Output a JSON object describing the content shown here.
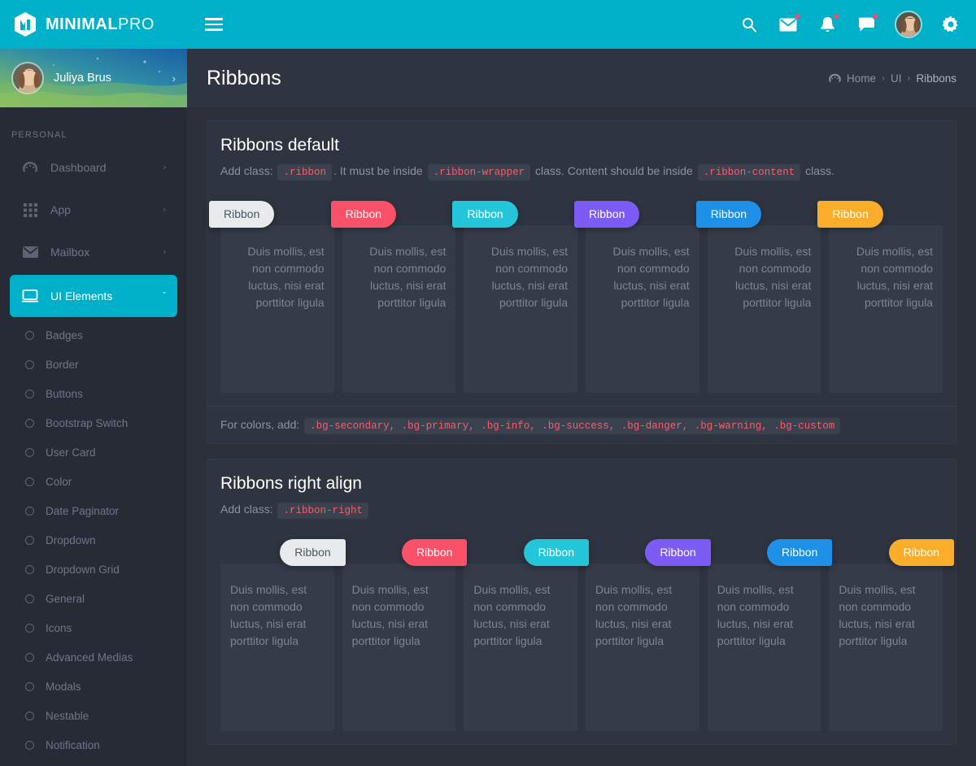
{
  "brand": {
    "bold": "MINIMAL",
    "light": "PRO"
  },
  "topbar": {
    "menu_toggle": "menu-toggle",
    "icons": [
      {
        "name": "search-icon",
        "badge": false
      },
      {
        "name": "mail-icon",
        "badge": true
      },
      {
        "name": "bell-icon",
        "badge": true
      },
      {
        "name": "chat-icon",
        "badge": true
      }
    ]
  },
  "profile": {
    "name": "Juliya Brus",
    "caret": "›"
  },
  "sidebar": {
    "section_title": "PERSONAL",
    "items": [
      {
        "label": "Dashboard",
        "icon": "gauge-icon",
        "caret": "›",
        "active": false
      },
      {
        "label": "App",
        "icon": "grid-icon",
        "caret": "›",
        "active": false
      },
      {
        "label": "Mailbox",
        "icon": "envelope-icon",
        "caret": "›",
        "active": false
      },
      {
        "label": "UI Elements",
        "icon": "monitor-icon",
        "caret": "ˇ",
        "active": true
      }
    ],
    "sub_items": [
      {
        "label": "Badges"
      },
      {
        "label": "Border"
      },
      {
        "label": "Buttons"
      },
      {
        "label": "Bootstrap Switch"
      },
      {
        "label": "User Card"
      },
      {
        "label": "Color"
      },
      {
        "label": "Date Paginator"
      },
      {
        "label": "Dropdown"
      },
      {
        "label": "Dropdown Grid"
      },
      {
        "label": "General"
      },
      {
        "label": "Icons"
      },
      {
        "label": "Advanced Medias"
      },
      {
        "label": "Modals"
      },
      {
        "label": "Nestable"
      },
      {
        "label": "Notification"
      }
    ]
  },
  "page": {
    "title": "Ribbons",
    "breadcrumb": {
      "home": "Home",
      "section": "UI",
      "current": "Ribbons",
      "sep": "›"
    }
  },
  "cards": [
    {
      "title": "Ribbons default",
      "desc_parts": [
        {
          "type": "text",
          "value": "Add class: "
        },
        {
          "type": "code",
          "value": ".ribbon"
        },
        {
          "type": "text",
          "value": ". It must be inside "
        },
        {
          "type": "code",
          "value": ".ribbon-wrapper"
        },
        {
          "type": "text",
          "value": " class. Content should be inside "
        },
        {
          "type": "code",
          "value": ".ribbon-content"
        },
        {
          "type": "text",
          "value": " class."
        }
      ],
      "align": "left",
      "footer": {
        "label": "For colors, add:",
        "code": ".bg-secondary, .bg-primary, .bg-info, .bg-success, .bg-danger, .bg-warning, .bg-custom"
      },
      "ribbons": [
        {
          "label": "Ribbon",
          "variant": "bg-secondary",
          "color": "#e7ebee"
        },
        {
          "label": "Ribbon",
          "variant": "bg-primary",
          "color": "#fa5068"
        },
        {
          "label": "Ribbon",
          "variant": "bg-info",
          "color": "#26c6da"
        },
        {
          "label": "Ribbon",
          "variant": "bg-success",
          "color": "#7c5cf5"
        },
        {
          "label": "Ribbon",
          "variant": "bg-danger",
          "color": "#1e90e8"
        },
        {
          "label": "Ribbon",
          "variant": "bg-warning",
          "color": "#f9ad2a"
        }
      ],
      "content_text": "Duis mollis, est non commodo luctus, nisi erat porttitor ligula"
    },
    {
      "title": "Ribbons right align",
      "desc_parts": [
        {
          "type": "text",
          "value": "Add class: "
        },
        {
          "type": "code",
          "value": ".ribbon-right"
        }
      ],
      "align": "right",
      "footer": null,
      "ribbons": [
        {
          "label": "Ribbon",
          "variant": "bg-secondary",
          "color": "#e7ebee"
        },
        {
          "label": "Ribbon",
          "variant": "bg-primary",
          "color": "#fa5068"
        },
        {
          "label": "Ribbon",
          "variant": "bg-info",
          "color": "#26c6da"
        },
        {
          "label": "Ribbon",
          "variant": "bg-success",
          "color": "#7c5cf5"
        },
        {
          "label": "Ribbon",
          "variant": "bg-danger",
          "color": "#1e90e8"
        },
        {
          "label": "Ribbon",
          "variant": "bg-warning",
          "color": "#f9ad2a"
        }
      ],
      "content_text": "Duis mollis, est non commodo luctus, nisi erat porttitor ligula"
    }
  ],
  "colors": {
    "brand": "#00b0c8",
    "sidebar_bg": "#262b36",
    "page_bg": "#2b303b",
    "card_bg": "#2e3440",
    "ribbon_content_bg": "#353c49",
    "badge": "#fa4a64"
  }
}
